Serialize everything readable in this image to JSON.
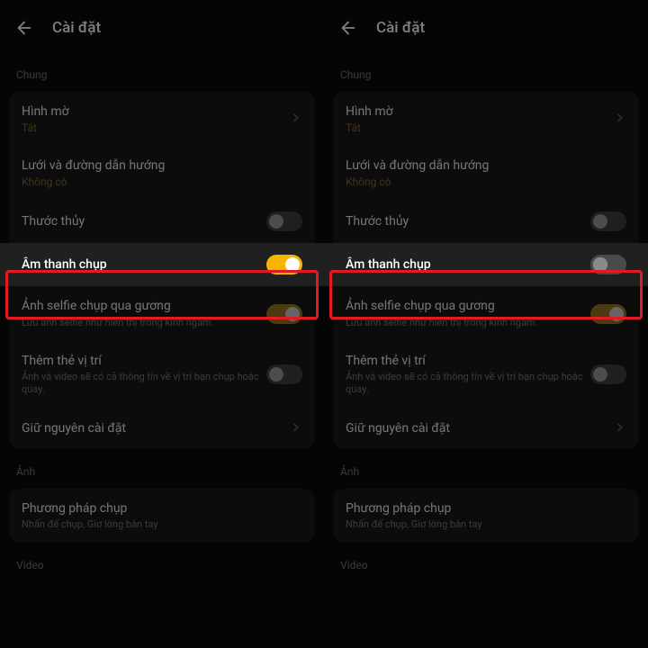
{
  "header": {
    "title": "Cài đặt"
  },
  "sections": {
    "general": "Chung",
    "image": "Ảnh",
    "video": "Video"
  },
  "rows": {
    "watermark": {
      "title": "Hình mờ",
      "value": "Tắt"
    },
    "grid": {
      "title": "Lưới và đường dẫn hướng",
      "value": "Không có"
    },
    "level": {
      "title": "Thước thủy"
    },
    "shutter_sound": {
      "title": "Âm thanh chụp"
    },
    "mirror_selfie": {
      "title": "Ảnh selfie chụp qua gương",
      "desc": "Lưu ảnh selfie như hiển thị trong kính ngắm."
    },
    "location_tag": {
      "title": "Thêm thẻ vị trí",
      "desc": "Ảnh và video sẽ có cả thông tin về vị trí bạn chụp hoặc quay."
    },
    "keep_settings": {
      "title": "Giữ nguyên cài đặt"
    },
    "capture_method": {
      "title": "Phương pháp chụp",
      "desc": "Nhấn để chụp, Giơ lòng bàn tay"
    }
  }
}
